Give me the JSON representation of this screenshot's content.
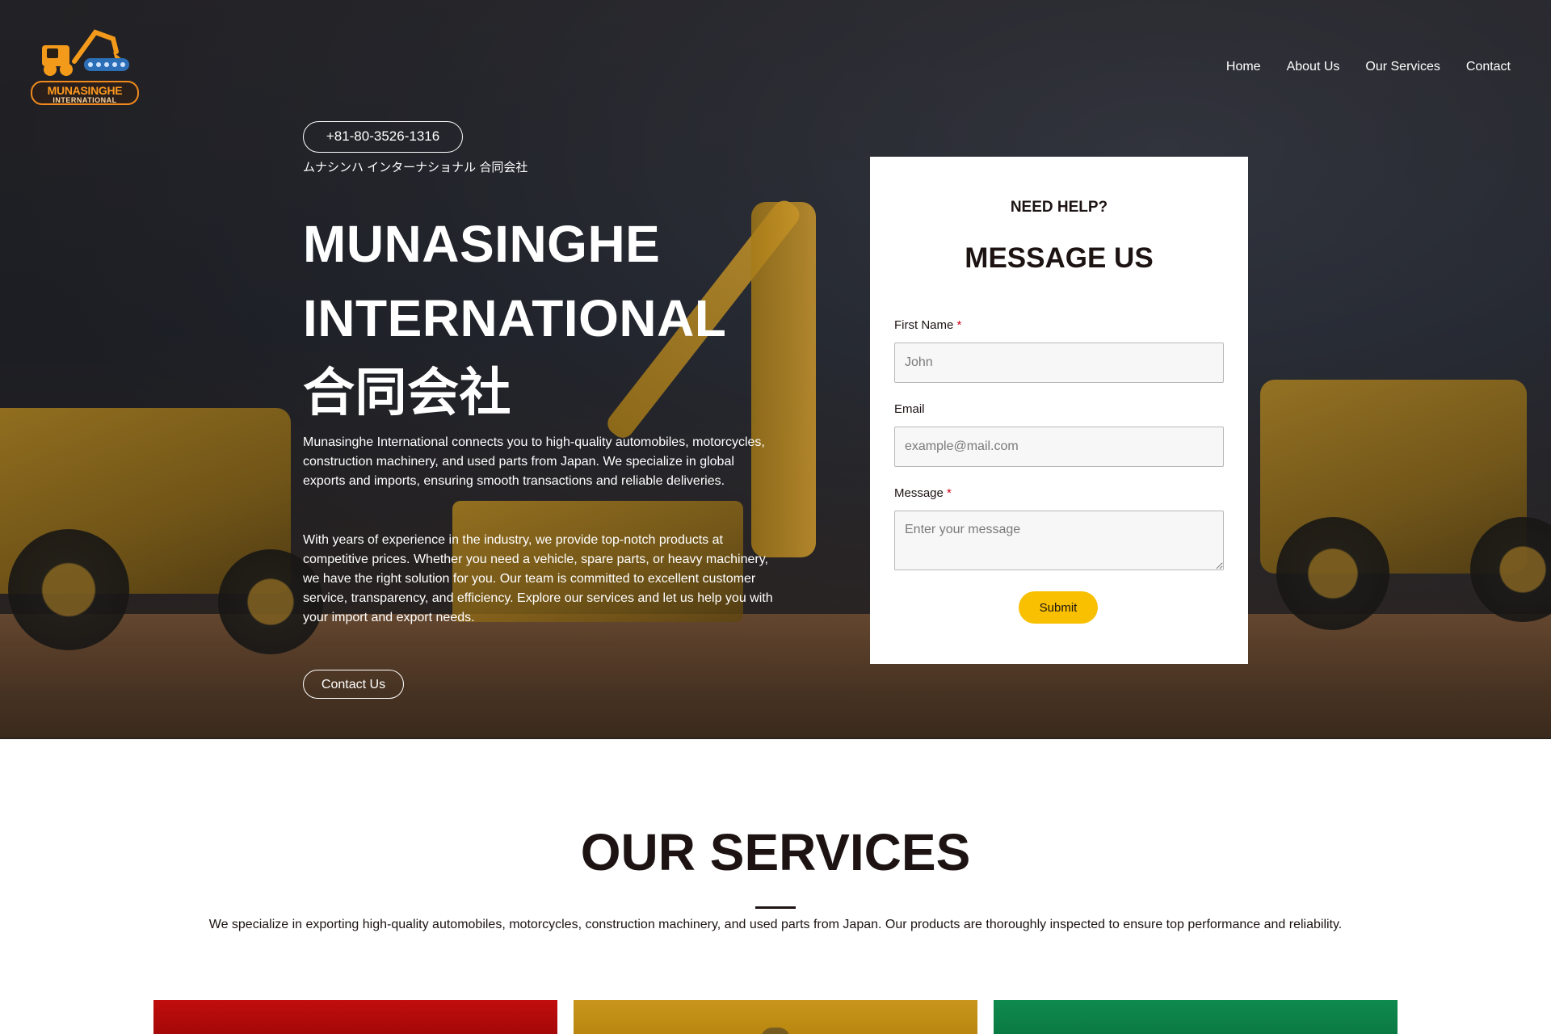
{
  "logo": {
    "line1": "MUNASINGHE",
    "line2": "INTERNATIONAL"
  },
  "nav": {
    "items": [
      "Home",
      "About Us",
      "Our Services",
      "Contact"
    ]
  },
  "hero": {
    "phone": "+81-80-3526-1316",
    "jp_subtitle": "ムナシンハ インターナショナル 合同会社",
    "title_lines": [
      "MUNASINGHE",
      "INTERNATIONAL",
      "合同会社"
    ],
    "paragraph1": "Munasinghe International connects you to high-quality automobiles, motorcycles, construction machinery, and used parts from Japan. We specialize in global exports and imports, ensuring smooth transactions and reliable deliveries.",
    "paragraph2": "With years of experience in the industry, we provide top-notch products at competitive prices. Whether you need a vehicle, spare parts, or heavy machinery, we have the right solution for you. Our team is committed to excellent customer service, transparency, and efficiency. Explore our services and let us help you with your import and export needs.",
    "cta": "Contact Us"
  },
  "form": {
    "eyebrow": "NEED HELP?",
    "title": "MESSAGE US",
    "first_name_label": "First Name",
    "first_name_placeholder": "John",
    "email_label": "Email",
    "email_placeholder": "example@mail.com",
    "message_label": "Message",
    "message_placeholder": "Enter your message",
    "required_mark": "*",
    "submit": "Submit"
  },
  "services": {
    "title": "OUR SERVICES",
    "description": "We specialize in exporting high-quality automobiles, motorcycles, construction machinery, and used parts from Japan. Our products are thoroughly inspected to ensure top performance and reliability."
  },
  "colors": {
    "accent": "#f8c000",
    "text": "#1d1313",
    "required": "#d0021b",
    "logo_orange": "#ff9a1f"
  }
}
